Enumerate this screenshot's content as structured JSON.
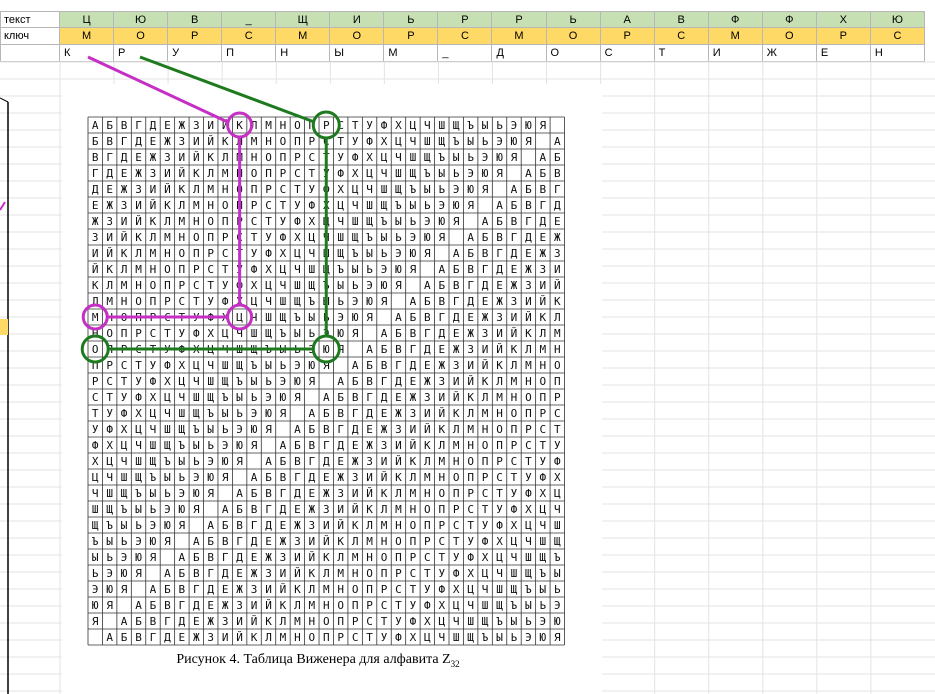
{
  "sheet": {
    "row_text": {
      "label": "текст",
      "cells": [
        "Ц",
        "Ю",
        "В",
        "_",
        "Щ",
        "И",
        "Ь",
        "Р",
        "Р",
        "Ь",
        "А",
        "В",
        "Ф",
        "Ф",
        "Х",
        "Ю"
      ]
    },
    "row_key": {
      "label": "ключ",
      "cells": [
        "М",
        "О",
        "Р",
        "С",
        "М",
        "О",
        "Р",
        "С",
        "М",
        "О",
        "Р",
        "С",
        "М",
        "О",
        "Р",
        "С"
      ]
    },
    "row_result": {
      "cells": [
        "К",
        "Р",
        "У",
        "П",
        "Н",
        "Ы",
        "М",
        "_",
        "Д",
        "О",
        "С",
        "Т",
        "И",
        "Ж",
        "Е",
        "Н"
      ]
    },
    "colors": {
      "text_row_fill": "#c6e0b4",
      "key_row_fill": "#ffd966",
      "grid_line": "#b7b7b7",
      "highlight_magenta": "#c52fc5",
      "highlight_green": "#1e7a1e"
    }
  },
  "figure": {
    "alphabet": "АБВГДЕЖЗИЙКЛМНОПРСТУФХЦЧШЩЪЫЬЭЮЯ ",
    "caption_main": "Рисунок 4. Таблица Виженера для алфавита Z",
    "caption_sub": "32"
  }
}
